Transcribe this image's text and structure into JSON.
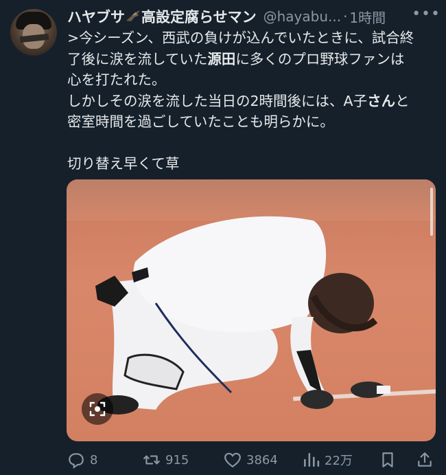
{
  "tweet": {
    "display_name": "ハヤブサ",
    "display_name_suffix": "高設定腐らせマン",
    "handle": "@hayabu...",
    "separator": "·",
    "time": "1時間",
    "more": "•••",
    "lines": {
      "l1": ">今シーズン、西武の負けが込んでいたときに、試合終",
      "l2a": "了後に涙を流していた",
      "l2b": "源田",
      "l2c": "に多くのプロ野球ファンは",
      "l3": "心を打たれた。",
      "l4a": "しかしその涙を流した当日の2時間後には、A子",
      "l4b": "さん",
      "l4c": "と",
      "l5": "密室時間を過ごしていたことも明らかに。",
      "l7": "切り替え早くて草"
    }
  },
  "actions": {
    "replies": "8",
    "retweets": "915",
    "likes": "3864",
    "views": "22万"
  },
  "colors": {
    "background": "#15202b",
    "text": "#e7e9ea",
    "muted": "#8b98a5"
  }
}
